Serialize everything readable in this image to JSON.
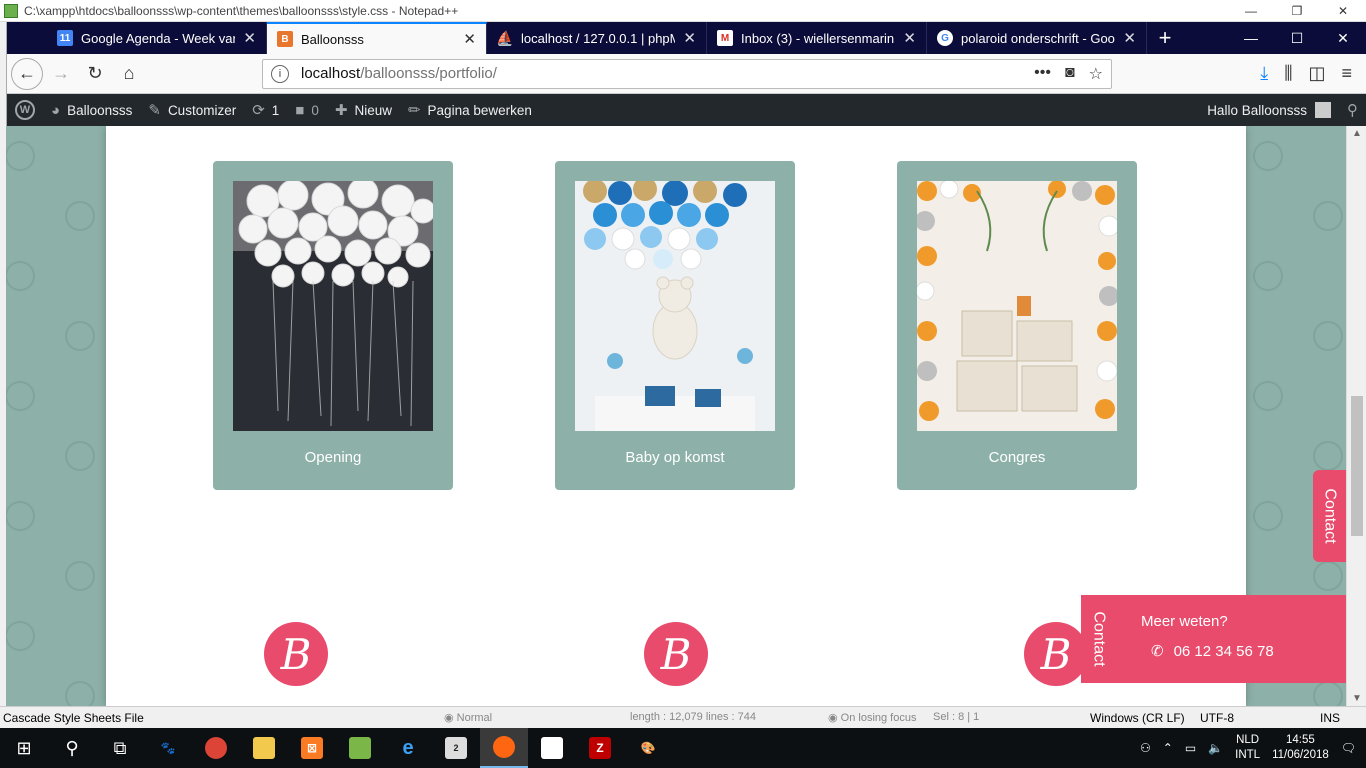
{
  "notepad": {
    "title": "C:\\xampp\\htdocs\\balloonsss\\wp-content\\themes\\balloonsss\\style.css - Notepad++",
    "status": {
      "filetype": "Cascade Style Sheets File",
      "mode": "Normal",
      "length": "length : 12,079    lines : 744",
      "focus": "On losing focus",
      "sel": "Sel : 8 | 1",
      "eol": "Windows (CR LF)",
      "encoding": "UTF-8",
      "ins": "INS"
    }
  },
  "browser": {
    "tabs": [
      {
        "label": "Google Agenda - Week van 10",
        "favicon": "11",
        "color": "#4285f4"
      },
      {
        "label": "Balloonsss",
        "favicon": "B",
        "color": "#e8762c",
        "active": true
      },
      {
        "label": "localhost / 127.0.0.1 | phpMyA",
        "favicon": "pma",
        "color": "#f29111"
      },
      {
        "label": "Inbox (3) - wiellersenmarin@g",
        "favicon": "M",
        "color": "#d93025"
      },
      {
        "label": "polaroid onderschrift - Google",
        "favicon": "G",
        "color": "#4285f4"
      }
    ],
    "url_host": "localhost",
    "url_path": "/balloonsss/portfolio/"
  },
  "wpbar": {
    "site": "Balloonsss",
    "customizer": "Customizer",
    "updates": "1",
    "comments": "0",
    "new": "Nieuw",
    "edit": "Pagina bewerken",
    "greeting": "Hallo Balloonsss"
  },
  "portfolio": {
    "cards": [
      {
        "caption": "Opening"
      },
      {
        "caption": "Baby op komst"
      },
      {
        "caption": "Congres"
      }
    ],
    "logo_letter": "B"
  },
  "contact": {
    "tab_label": "Contact",
    "panel_label": "Contact",
    "title": "Meer weten?",
    "phone": "06 12 34 56 78"
  },
  "taskbar": {
    "lang_top": "NLD",
    "lang_bottom": "INTL",
    "time": "14:55",
    "date": "11/06/2018",
    "mail_badge": "2"
  },
  "colors": {
    "accent": "#e84b6b",
    "teal": "#8db1a9",
    "wp_bar": "#23282d"
  }
}
